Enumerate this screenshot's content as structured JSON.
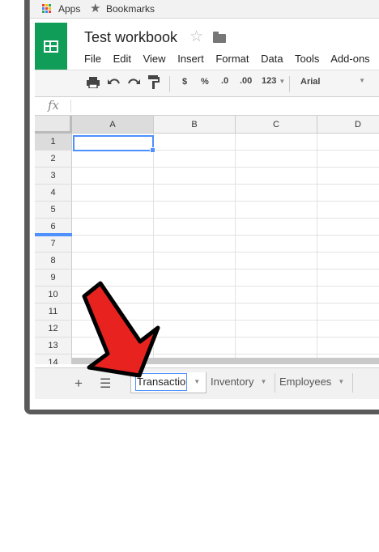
{
  "bookmarks_bar": {
    "apps_label": "Apps",
    "bookmarks_label": "Bookmarks"
  },
  "document": {
    "title": "Test workbook"
  },
  "menu": [
    "File",
    "Edit",
    "View",
    "Insert",
    "Format",
    "Data",
    "Tools",
    "Add-ons"
  ],
  "toolbar": {
    "currency": "$",
    "percent": "%",
    "decrease_decimals": ".0",
    "increase_decimals": ".00",
    "more_formats": "123",
    "font": "Arial"
  },
  "formula_bar": {
    "fx_label": "fx",
    "value": ""
  },
  "grid": {
    "columns": [
      "A",
      "B",
      "C",
      "D"
    ],
    "rows": [
      "1",
      "2",
      "3",
      "4",
      "5",
      "6",
      "7",
      "8",
      "9",
      "10",
      "11",
      "12",
      "13",
      "14"
    ],
    "selected_cell": "A1"
  },
  "sheets": {
    "tabs": [
      "Transactio",
      "Inventory",
      "Employees"
    ],
    "active": "Transactio"
  },
  "colors": {
    "logo": "#0f9d58",
    "selection": "#4d90fe",
    "arrow": "#e8231f"
  }
}
